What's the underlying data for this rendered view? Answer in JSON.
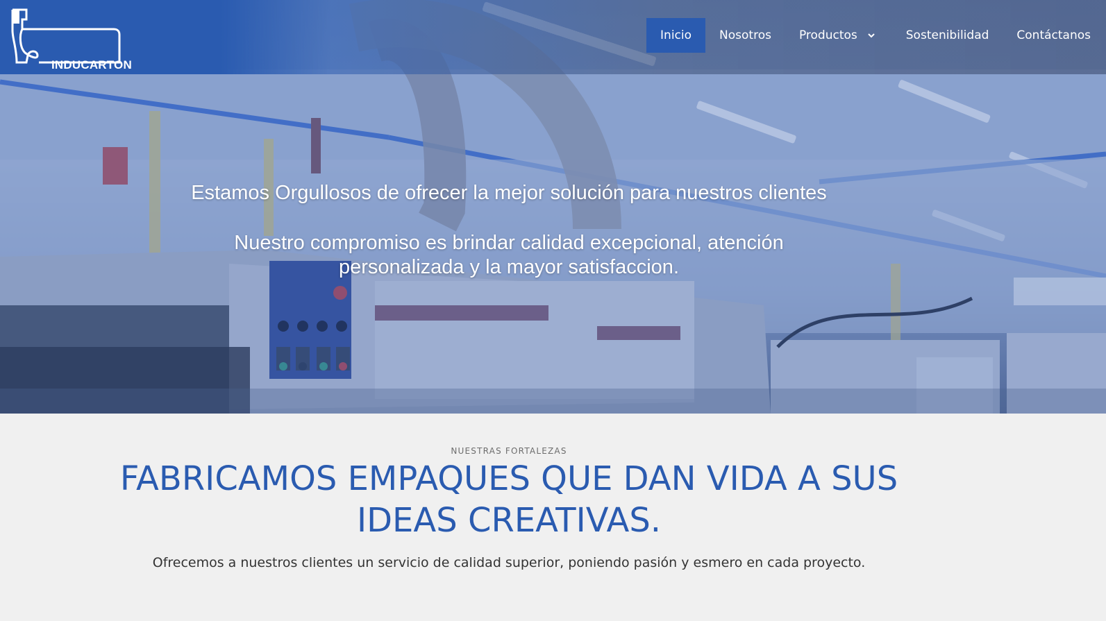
{
  "brand": {
    "name": "INDUCARTON"
  },
  "nav": {
    "items": [
      {
        "label": "Inicio",
        "active": true
      },
      {
        "label": "Nosotros"
      },
      {
        "label": "Productos",
        "has_dropdown": true
      },
      {
        "label": "Sostenibilidad"
      },
      {
        "label": "Contáctanos"
      }
    ]
  },
  "hero": {
    "headline": "Estamos Orgullosos de ofrecer la mejor solución para nuestros clientes",
    "subheadline": "Nuestro compromiso es brindar calidad excepcional, atención personalizada y la mayor satisfaccion."
  },
  "section": {
    "eyebrow": "NUESTRAS FORTALEZAS",
    "title": "FABRICAMOS EMPAQUES QUE DAN VIDA A SUS IDEAS CREATIVAS.",
    "description": "Ofrecemos a nuestros clientes un servicio de calidad superior, poniendo pasión y esmero en cada proyecto."
  },
  "colors": {
    "brand_blue": "#2a5bb0",
    "section_bg": "#f0f0f0"
  }
}
